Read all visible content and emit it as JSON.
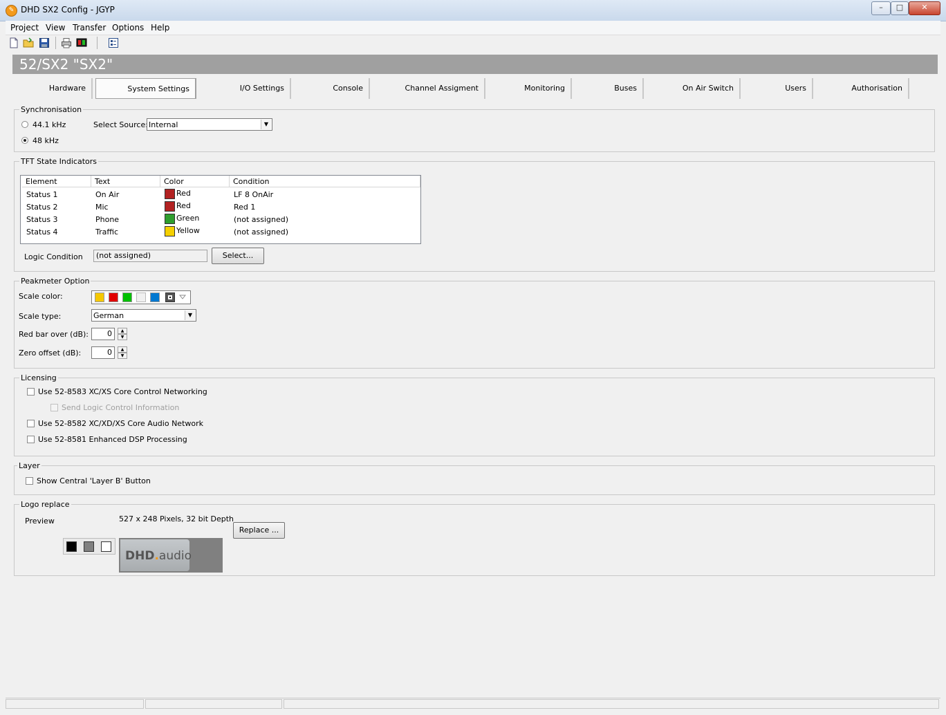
{
  "window": {
    "title": "DHD SX2 Config - JGYP",
    "minimize_glyph": "–",
    "maximize_glyph": "□",
    "close_glyph": "✕"
  },
  "menu": [
    "Project",
    "View",
    "Transfer",
    "Options",
    "Help"
  ],
  "toolbar": {
    "icons": [
      "new-file-icon",
      "open-folder-icon",
      "save-icon",
      "print-icon",
      "device-icon",
      "properties-icon"
    ]
  },
  "header": {
    "title": "52/SX2 \"SX2\""
  },
  "tabs": [
    {
      "label": "Hardware"
    },
    {
      "label": "System Settings"
    },
    {
      "label": "I/O Settings"
    },
    {
      "label": "Console"
    },
    {
      "label": "Channel Assigment"
    },
    {
      "label": "Monitoring"
    },
    {
      "label": "Buses"
    },
    {
      "label": "On Air Switch"
    },
    {
      "label": "Users"
    },
    {
      "label": "Authorisation"
    }
  ],
  "sync": {
    "title": "Synchronisation",
    "opt1": "44.1 kHz",
    "opt2": "48 kHz",
    "selected": "48 kHz",
    "source_label": "Select Source:",
    "source_value": "Internal"
  },
  "tft": {
    "title": "TFT State Indicators",
    "columns": [
      "Element",
      "Text",
      "Color",
      "Condition"
    ],
    "rows": [
      {
        "element": "Status 1",
        "text": "On Air",
        "color": "Red",
        "hex": "#b22222",
        "condition": "LF 8 OnAir"
      },
      {
        "element": "Status 2",
        "text": "Mic",
        "color": "Red",
        "hex": "#b22222",
        "condition": "Red 1"
      },
      {
        "element": "Status 3",
        "text": "Phone",
        "color": "Green",
        "hex": "#2e9e2e",
        "condition": "(not assigned)"
      },
      {
        "element": "Status 4",
        "text": "Traffic",
        "color": "Yellow",
        "hex": "#f5d000",
        "condition": "(not assigned)"
      }
    ],
    "logic_label": "Logic Condition",
    "logic_value": "(not assigned)",
    "select_button": "Select..."
  },
  "peak": {
    "title": "Peakmeter Option",
    "scale_color_label": "Scale color:",
    "scale_colors": [
      "#f5c800",
      "#e00000",
      "#00c000",
      "#f0f0f0",
      "#0078d0"
    ],
    "scale_type_label": "Scale type:",
    "scale_type_value": "German",
    "red_bar_label": "Red bar over (dB):",
    "red_bar_value": "0",
    "zero_offset_label": "Zero offset (dB):",
    "zero_offset_value": "0"
  },
  "licensing": {
    "title": "Licensing",
    "opt1": "Use 52-8583 XC/XS Core Control Networking",
    "opt1_sub": "Send Logic Control Information",
    "opt2": "Use 52-8582 XC/XD/XS Core Audio Network",
    "opt3": "Use 52-8581 Enhanced DSP Processing"
  },
  "layer": {
    "title": "Layer",
    "opt1": "Show Central 'Layer B' Button"
  },
  "logo": {
    "title": "Logo replace",
    "preview_label": "Preview",
    "info": "527 x 248 Pixels, 32 bit Depth",
    "replace_button": "Replace ...",
    "logo_text_main": "DHD",
    "logo_text_dot": ".",
    "logo_text_sub": "audio"
  }
}
